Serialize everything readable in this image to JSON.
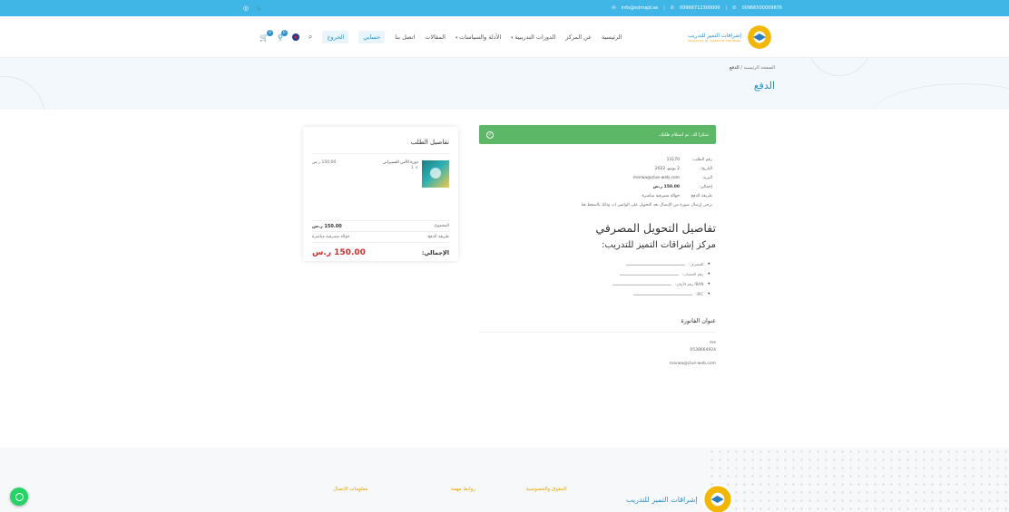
{
  "topbar": {
    "social": [
      "◎",
      "🐦"
    ],
    "phone1": "00966500009876",
    "phone2": "00966712300000",
    "email": "info@edmajd.sa"
  },
  "header": {
    "logo_ar": "إشراقات التميز للتدريب",
    "logo_en": "ISHRAQAT AL TAMAYOZ TRAINING",
    "nav": [
      "الرئيسية",
      "عن المركز",
      "الدورات التدريبية",
      "الأدلة والسياسات",
      "المقالات",
      "اتصل بنا"
    ],
    "account": "حسابي",
    "logout": "الخروج",
    "cart_count": "0",
    "wish_count": "0"
  },
  "banner": {
    "breadcrumb_home": "الصفحة الرئيسية",
    "breadcrumb_sep": "/",
    "breadcrumb_current": "الدفع",
    "title": "الدفع"
  },
  "order": {
    "alert": "شكرا لك. تم استلام طلبك.",
    "rows": [
      {
        "label": "رقم الطلب:",
        "value": "13170"
      },
      {
        "label": "التاريخ:",
        "value": "2 يونيو، 2022"
      },
      {
        "label": "البريد:",
        "value": "marwa@clue-web.com"
      },
      {
        "label": "إجمالي:",
        "value": "150.00 ر.س"
      },
      {
        "label": "طريقة الدفع:",
        "value": "حوالة مصرفية مباشرة"
      }
    ],
    "note": "يرجى إرسال صورة من الإيصال بعد التحويل على الواتس اب وذلك بالضغط هنا",
    "bank_heading": "تفاصيل التحويل المصرفي",
    "bank_name": "مركز إشراقات التميز للتدريب:",
    "bank_fields": [
      "المصرف:",
      "رقم الحساب:",
      "IBAN رقم الآيبان:",
      "BIC:"
    ],
    "address_title": "عنوان الفاتورة",
    "address_lines": [
      "me",
      "0538664924"
    ],
    "address_email": "marwa@clue-web.com"
  },
  "card": {
    "title": "تفاصيل الطلب",
    "item_name": "دورة الأمن السيبراني",
    "item_qty": "× 1",
    "item_price": "150.00 ر.س",
    "subtotal_label": "المجموع:",
    "subtotal_value": "150.00 ر.س",
    "payment_label": "طريقة الدفع:",
    "payment_value": "حوالة مصرفية مباشرة",
    "total_label": "الإجمالي:",
    "total_value": "150.00 ر.س"
  },
  "footer": {
    "col_rights": "الحقوق والخصوصية",
    "col_links": "روابط مهمة",
    "col_contact": "معلومات الاتصال",
    "logo_ar": "إشراقات التميز للتدريب"
  }
}
